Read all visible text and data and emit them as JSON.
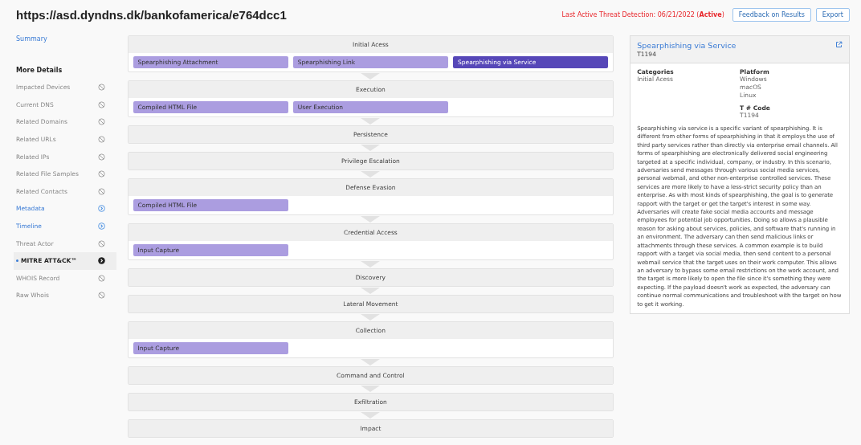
{
  "title": "https://asd.dyndns.dk/bankofamerica/e764dcc1",
  "detection": "Last Active Threat Detection: 06/21/2022 (**Active**)",
  "buttons": [
    "Feedback on Results",
    "Export"
  ],
  "sidebar": {
    "summary": "Summary",
    "heading": "More Details",
    "items": [
      {
        "label": "Impacted Devices",
        "kind": "blocked",
        "selected": false
      },
      {
        "label": "Current DNS",
        "kind": "blocked",
        "selected": false
      },
      {
        "label": "Related Domains",
        "kind": "blocked",
        "selected": false
      },
      {
        "label": "Related URLs",
        "kind": "blocked",
        "selected": false
      },
      {
        "label": "Related IPs",
        "kind": "blocked",
        "selected": false
      },
      {
        "label": "Related File Samples",
        "kind": "blocked",
        "selected": false
      },
      {
        "label": "Related Contacts",
        "kind": "blocked",
        "selected": false
      },
      {
        "label": "Metadata",
        "kind": "available",
        "selected": false
      },
      {
        "label": "Timeline",
        "kind": "available",
        "selected": false
      },
      {
        "label": "Threat Actor",
        "kind": "blocked",
        "selected": false
      },
      {
        "label": "MITRE ATT&CK™",
        "kind": "available",
        "selected": true
      },
      {
        "label": "WHOIS Record",
        "kind": "blocked",
        "selected": false
      },
      {
        "label": "Raw Whois",
        "kind": "blocked",
        "selected": false
      }
    ]
  },
  "tactics": [
    {
      "name": "Initial Acess",
      "techniques": [
        {
          "name": "Spearphishing Attachment",
          "selected": false
        },
        {
          "name": "Spearphishing Link",
          "selected": false
        },
        {
          "name": "Spearphishing via Service",
          "selected": true
        }
      ]
    },
    {
      "name": "Execution",
      "techniques": [
        {
          "name": "Compiled HTML File",
          "selected": false
        },
        {
          "name": "User Execution",
          "selected": false
        }
      ]
    },
    {
      "name": "Persistence"
    },
    {
      "name": "Privilege Escalation"
    },
    {
      "name": "Defense Evasion",
      "techniques": [
        {
          "name": "Compiled HTML File",
          "selected": false
        }
      ]
    },
    {
      "name": "Credential Access",
      "techniques": [
        {
          "name": "Input Capture",
          "selected": false
        }
      ]
    },
    {
      "name": "Discovery"
    },
    {
      "name": "Lateral Movement"
    },
    {
      "name": "Collection",
      "techniques": [
        {
          "name": "Input Capture",
          "selected": false
        }
      ]
    },
    {
      "name": "Command and Control"
    },
    {
      "name": "Exfiltration"
    },
    {
      "name": "Impact"
    }
  ],
  "detail": {
    "title": "Spearphishing via Service",
    "id": "T1194",
    "categories_label": "Categories",
    "categories": [
      "Initial Acess"
    ],
    "platform_label": "Platform",
    "platforms": [
      "Windows",
      "macOS",
      "Linux"
    ],
    "code_label": "T # Code",
    "code": "T1194",
    "description": "Spearphishing via service is a specific variant of spearphishing. It is different from other forms of spearphishing in that it employs the use of third party services rather than directly via enterprise email channels. All forms of spearphishing are electronically delivered social engineering targeted at a specific individual, company, or industry. In this scenario, adversaries send messages through various social media services, personal webmail, and other non-enterprise controlled services. These services are more likely to have a less-strict security policy than an enterprise. As with most kinds of spearphishing, the goal is to generate rapport with the target or get the target's interest in some way. Adversaries will create fake social media accounts and message employees for potential job opportunities. Doing so allows a plausible reason for asking about services, policies, and software that's running in an environment. The adversary can then send malicious links or attachments through these services. A common example is to build rapport with a target via social media, then send content to a personal webmail service that the target uses on their work computer. This allows an adversary to bypass some email restrictions on the work account, and the target is more likely to open the file since it's something they were expecting. If the payload doesn't work as expected, the adversary can continue normal communications and troubleshoot with the target on how to get it working."
  }
}
